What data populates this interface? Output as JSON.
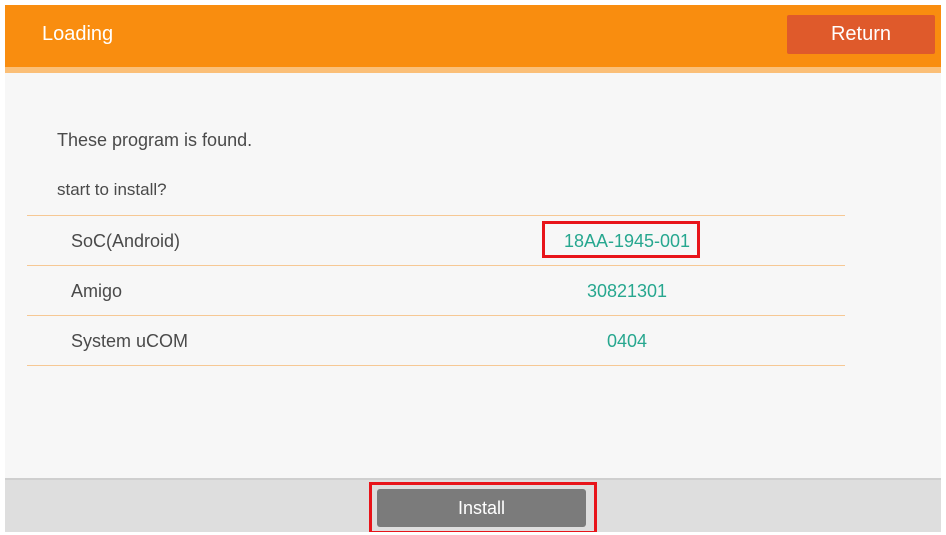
{
  "header": {
    "title": "Loading",
    "return_label": "Return"
  },
  "message": {
    "line1": "These program is found.",
    "line2": "start to install?"
  },
  "programs": [
    {
      "name": "SoC(Android)",
      "version": "18AA-1945-001"
    },
    {
      "name": "Amigo",
      "version": "30821301"
    },
    {
      "name": "System uCOM",
      "version": "0404"
    }
  ],
  "footer": {
    "install_label": "Install"
  },
  "colors": {
    "header": "#f98d0f",
    "return_button": "#df5a2b",
    "value_text": "#27a78f",
    "highlight": "#e8141a"
  }
}
